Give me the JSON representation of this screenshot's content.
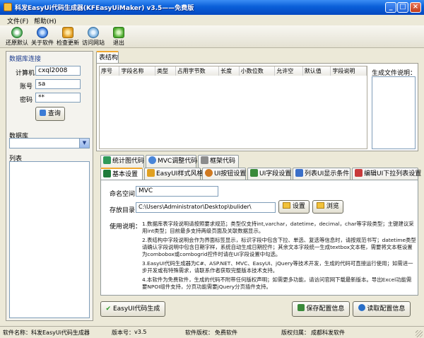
{
  "window": {
    "title": "科发EasyUi代码生成器(KFEasyUiMaker) v3.5——免费版"
  },
  "menu": {
    "items": [
      "文件(F)",
      "帮助(H)"
    ]
  },
  "toolbar": {
    "items": [
      {
        "label": "还原默认",
        "icon": "refresh-icon"
      },
      {
        "label": "关于软件",
        "icon": "info-icon"
      },
      {
        "label": "检查更新",
        "icon": "update-icon"
      },
      {
        "label": "访问网站",
        "icon": "globe-icon"
      },
      {
        "label": "退出",
        "icon": "exit-icon"
      }
    ]
  },
  "db": {
    "title": "数据库连接",
    "server_label": "计算机",
    "server_value": "cxql2008",
    "user_label": "账号",
    "user_value": "sa",
    "password_label": "密码",
    "password_value": "**",
    "query_button": "查询",
    "database_label": "数据库",
    "tables_label": "列表"
  },
  "table_tab": "表结构",
  "table_headers": [
    "序号",
    "字段名称",
    "类型",
    "占用字节数",
    "长度",
    "小数位数",
    "允许空",
    "默认值",
    "字段说明"
  ],
  "gen_files_label": "生成文件说明：",
  "tabs_row1": [
    "统计图代码",
    "MVC调整代码",
    "框架代码"
  ],
  "tabs_row2": [
    "基本设置",
    "EasyUI样式风格",
    "UI按钮设置",
    "UI字段设置",
    "列表UI显示条件",
    "编辑UI下拉列表设置"
  ],
  "settings": {
    "namespace_label": "命名空间",
    "namespace_value": "MVC",
    "dir_label": "存放目录",
    "dir_value": "C:\\Users\\Administrator\\Desktop\\bulider\\",
    "set_button": "设置",
    "browse_button": "浏览",
    "usage_label": "使用说明：",
    "usage": [
      "1.数据库表字段说明请按照要求规范；类型仅支持int,varchar，datetime，decimal，char等字段类型；主键建议采用int类型；目前最多支持两级页面及关联数据显示。",
      "2.表结构中字段说明会作为界面标签显示，标识字段中包含下拉、单选、复选等信息时，请按规范书写；datetime类型请确认字段说明中包含日期字样，系统自动生成日期控件；其余文本字段统一生成textbox文本框，需要将文本框设置为combobox或combogrid控件时请在UI字段设置中勾选。",
      "3.EasyUI代码生成器为C#、ASP.NET、MVC、EasyUI、jQuery等技术开发，生成的代码可直接运行使用；如需进一步开发或有特殊需求，请联系作者获取完整版本技术支持。",
      "4.本软件为免费软件，生成的代码不附带任何版权声明；如需更多功能，请访问官网下载最新版本。导出Excel功能需要NPOI组件支持，分页功能需要jQuery分页插件支持。"
    ]
  },
  "buttons": {
    "generate": "EasyUI代码生成",
    "save": "保存配置信息",
    "load": "读取配置信息"
  },
  "status": [
    {
      "label": "软件名称：",
      "value": "科发EasyUi代码生成器"
    },
    {
      "label": "版本号：",
      "value": "v3.5"
    },
    {
      "label": "软件版权：",
      "value": "免费软件"
    },
    {
      "label": "版权归属：",
      "value": "成都科发软件"
    }
  ]
}
